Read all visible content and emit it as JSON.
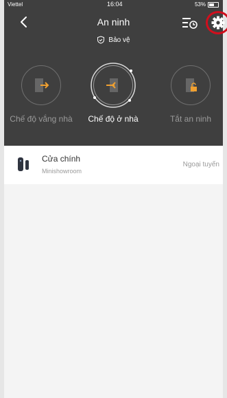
{
  "status_bar": {
    "carrier": "Viettel",
    "time": "16:04",
    "battery": "53%"
  },
  "header": {
    "title": "An ninh",
    "mode_label": "Bảo vệ"
  },
  "security_modes": [
    {
      "label": "Chế độ vắng nhà",
      "active": false
    },
    {
      "label": "Chế độ ở nhà",
      "active": true
    },
    {
      "label": "Tắt an ninh",
      "active": false
    }
  ],
  "device": {
    "name": "Cửa chính",
    "room": "Minishowroom",
    "status": "Ngoại tuyến"
  },
  "colors": {
    "accent": "#f0a030",
    "header_bg": "#3f3f3f",
    "highlight": "#d10f1d"
  },
  "icons": [
    "back-icon",
    "shield-icon",
    "history-icon",
    "gear-icon",
    "door-out-icon",
    "door-in-icon",
    "door-lock-icon",
    "door-sensor-icon"
  ]
}
